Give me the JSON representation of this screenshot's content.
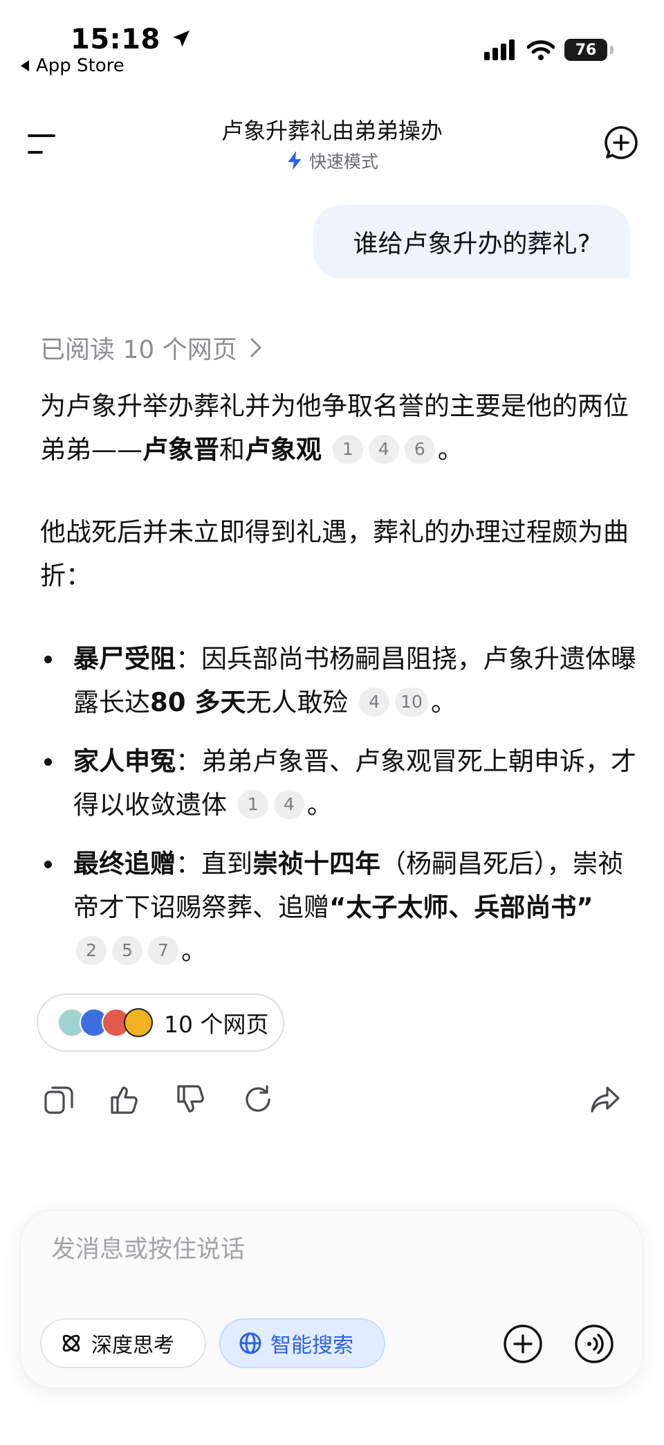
{
  "status_bar": {
    "time": "15:18",
    "back_label": "App Store",
    "battery": "76"
  },
  "header": {
    "title": "卢象升葬礼由弟弟操办",
    "mode_label": "快速模式"
  },
  "user_message": "谁给卢象升办的葬礼?",
  "answer": {
    "read_pages_label": "已阅读 10 个网页",
    "para1": {
      "t1": "为卢象升举办葬礼并为他争取名誉的主要是他的两位弟弟——",
      "b1": "卢象晋",
      "t2": "和",
      "b2": "卢象观",
      "cites": [
        "1",
        "4",
        "6"
      ],
      "end": "。"
    },
    "para2": "他战死后并未立即得到礼遇，葬礼的办理过程颇为曲折：",
    "bullets": [
      {
        "head": "暴尸受阻",
        "t1": "：因兵部尚书杨嗣昌阻挠，卢象升遗体曝露长达",
        "b1": "80 多天",
        "t2": "无人敢殓",
        "t3": "",
        "b2": "",
        "cites": [
          "4",
          "10"
        ],
        "end": "。"
      },
      {
        "head": "家人申冤",
        "t1": "：弟弟卢象晋、卢象观冒死上朝申诉，才得以收敛遗体",
        "b1": "",
        "t2": "",
        "t3": "",
        "b2": "",
        "cites": [
          "1",
          "4"
        ],
        "end": "。"
      },
      {
        "head": "最终追赠",
        "t1": "：直到",
        "b1": "崇祯十四年",
        "t2": "（杨嗣昌死后），崇祯帝才下诏赐祭葬、追赠",
        "t3": "",
        "b2": "“太子太师、兵部尚书”",
        "cites": [
          "2",
          "5",
          "7"
        ],
        "end": "。"
      }
    ],
    "sources_label": "10 个网页"
  },
  "composer": {
    "placeholder": "发消息或按住说话",
    "deep_think_label": "深度思考",
    "smart_search_label": "智能搜索"
  },
  "colors": {
    "accent": "#2a62e8",
    "user_bubble": "#eef3fd",
    "muted_text": "#8d8d93",
    "cite_bg": "#eeeeef"
  },
  "icons": [
    "location-arrow-icon",
    "back-triangle-icon",
    "signal-icon",
    "wifi-icon",
    "battery-icon",
    "menu-icon",
    "lightning-icon",
    "new-chat-icon",
    "chevron-right-icon",
    "copy-icon",
    "thumbs-up-icon",
    "thumbs-down-icon",
    "regenerate-icon",
    "share-icon",
    "deep-think-icon",
    "globe-icon",
    "plus-icon",
    "voice-icon"
  ]
}
